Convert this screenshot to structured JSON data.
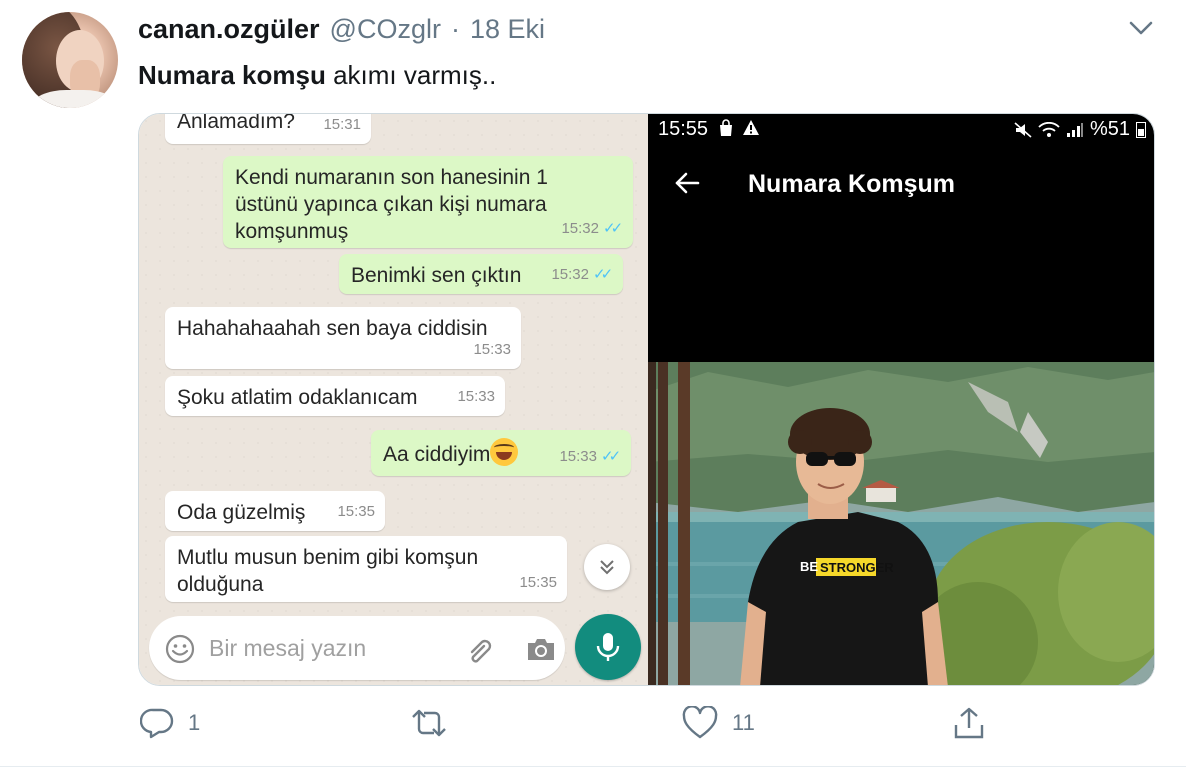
{
  "tweet": {
    "display_name": "canan.ozgüler",
    "handle": "@COzglr",
    "separator": "·",
    "date": "18 Eki",
    "text_bold": "Numara komşu",
    "text_rest": " akımı varmış.."
  },
  "chat": {
    "messages": [
      {
        "dir": "in",
        "text": "Anlamadım?",
        "time": "15:31"
      },
      {
        "dir": "out",
        "text": "Kendi numaranın son hanesinin 1 üstünü yapınca çıkan kişi numara komşunmuş",
        "time": "15:32",
        "read": true
      },
      {
        "dir": "out",
        "text": "Benimki sen çıktın",
        "time": "15:32",
        "read": true
      },
      {
        "dir": "in",
        "text": "Hahahahaahah sen baya ciddisin",
        "time": "15:33"
      },
      {
        "dir": "in",
        "text": "Şoku atlatim odaklanıcam",
        "time": "15:33"
      },
      {
        "dir": "out",
        "text": "Aa ciddiyim",
        "time": "15:33",
        "read": true,
        "emoji": "tears-of-joy"
      },
      {
        "dir": "in",
        "text": "Oda güzelmiş",
        "time": "15:35"
      },
      {
        "dir": "in",
        "text": "Mutlu musun benim gibi komşun olduğuna",
        "time": "15:35"
      }
    ],
    "input_placeholder": "Bir mesaj yazın",
    "colors": {
      "incoming": "#ffffff",
      "outgoing": "#dcf8c6",
      "background": "#ece5dd",
      "accent": "#128c7e",
      "read_ticks": "#4fc3f7"
    }
  },
  "profile": {
    "status_time": "15:55",
    "battery": "%51",
    "title": "Numara Komşum",
    "shirt_text_prefix": "BE",
    "shirt_text": "STRONGER"
  },
  "actions": {
    "reply_count": "1",
    "like_count": "11"
  }
}
